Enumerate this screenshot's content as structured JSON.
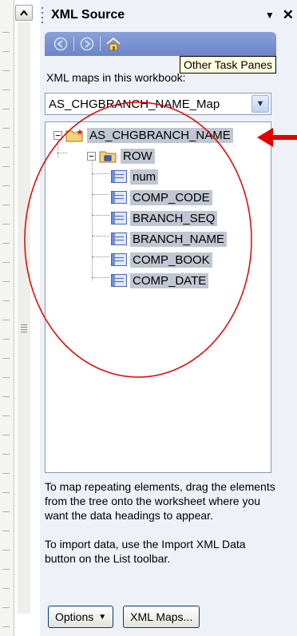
{
  "pane": {
    "title": "XML Source",
    "menu_icon": "dropdown-triangle-icon",
    "close_icon": "close-icon"
  },
  "nav": {
    "back_icon": "back-arrow-icon",
    "forward_icon": "forward-arrow-icon",
    "home_icon": "home-icon"
  },
  "tooltip": "Other Task Panes",
  "maps_label": "XML maps in this workbook:",
  "map_select": {
    "value": "AS_CHGBRANCH_NAME_Map"
  },
  "tree": {
    "root": "AS_CHGBRANCH_NAME",
    "row": "ROW",
    "fields": [
      "num",
      "COMP_CODE",
      "BRANCH_SEQ",
      "BRANCH_NAME",
      "COMP_BOOK",
      "COMP_DATE"
    ]
  },
  "help": {
    "p1": "To map repeating elements, drag the elements from the tree onto the worksheet where you want the data headings to appear.",
    "p2": "To import data, use the Import XML Data button on the List toolbar."
  },
  "buttons": {
    "options": "Options",
    "xml_maps": "XML Maps..."
  },
  "annotations": {
    "arrow_color": "#e00000",
    "circle_color": "#e00000"
  }
}
